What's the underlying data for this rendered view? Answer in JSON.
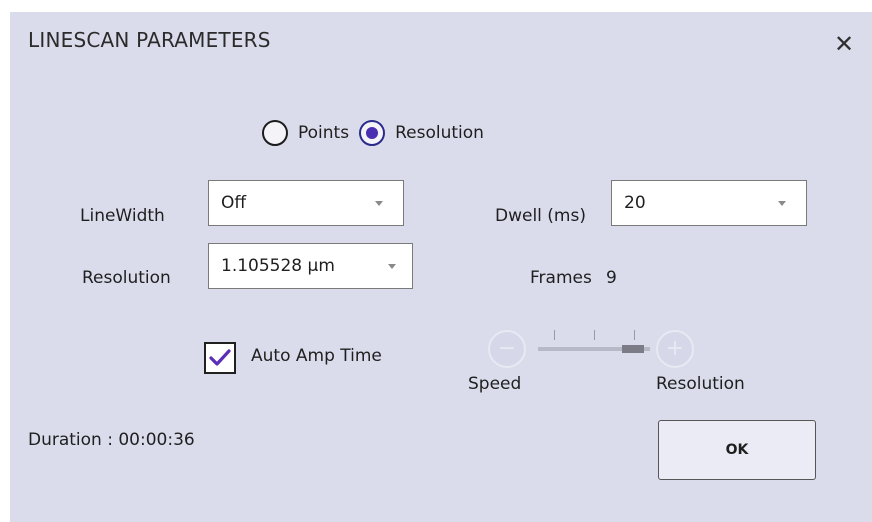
{
  "dialog": {
    "title": "LINESCAN PARAMETERS",
    "close_symbol": "✕"
  },
  "mode": {
    "options": [
      {
        "label": "Points",
        "selected": false
      },
      {
        "label": "Resolution",
        "selected": true
      }
    ]
  },
  "fields": {
    "linewidth_label": "LineWidth",
    "linewidth_value": "Off",
    "resolution_label": "Resolution",
    "resolution_value": "1.105528 µm",
    "dwell_label": "Dwell (ms)",
    "dwell_value": "20",
    "frames_label": "Frames",
    "frames_value": "9"
  },
  "auto_amp": {
    "label": "Auto Amp Time",
    "checked": true
  },
  "speed_slider": {
    "minus_symbol": "−",
    "plus_symbol": "+",
    "left_label": "Speed",
    "right_label": "Resolution",
    "position_fraction": 1.0
  },
  "footer": {
    "duration_label": "Duration : 00:00:36",
    "ok_label": "OK"
  },
  "colors": {
    "dialog_bg": "#dadcec",
    "radio_accent": "#4a2fb0",
    "check_accent": "#5c2eb8"
  }
}
